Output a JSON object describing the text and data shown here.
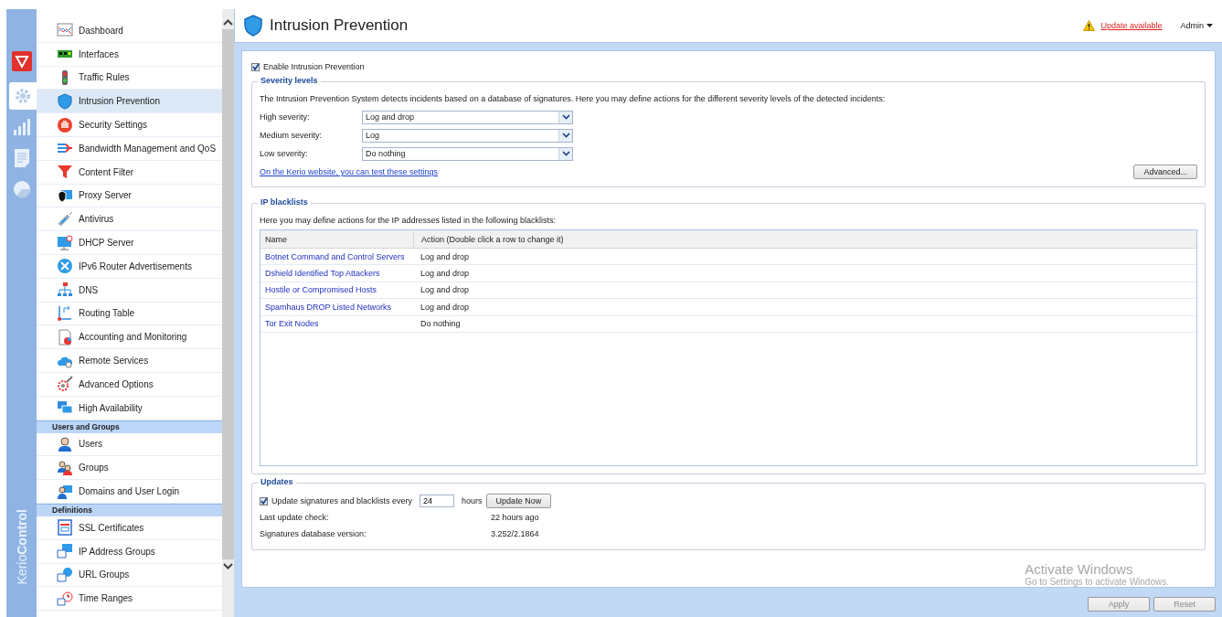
{
  "sidebar": {
    "rail": [
      {
        "selected": true
      },
      {
        "selected": false
      },
      {
        "selected": false
      },
      {
        "selected": false
      }
    ],
    "brand": "Kerio**Control**",
    "sections": [
      {
        "items": [
          {
            "label": "Dashboard",
            "selected": false
          },
          {
            "label": "Interfaces",
            "selected": false
          },
          {
            "label": "Traffic Rules",
            "selected": false
          },
          {
            "label": "Intrusion Prevention",
            "selected": true
          },
          {
            "label": "Security Settings",
            "selected": false
          },
          {
            "label": "Bandwidth Management and QoS",
            "selected": false
          },
          {
            "label": "Content Filter",
            "selected": false
          },
          {
            "label": "Proxy Server",
            "selected": false
          },
          {
            "label": "Antivirus",
            "selected": false
          },
          {
            "label": "DHCP Server",
            "selected": false
          },
          {
            "label": "IPv6 Router Advertisements",
            "selected": false
          },
          {
            "label": "DNS",
            "selected": false
          },
          {
            "label": "Routing Table",
            "selected": false
          },
          {
            "label": "Accounting and Monitoring",
            "selected": false
          },
          {
            "label": "Remote Services",
            "selected": false
          },
          {
            "label": "Advanced Options",
            "selected": false
          },
          {
            "label": "High Availability",
            "selected": false
          }
        ]
      },
      {
        "heading": "Users and Groups",
        "items": [
          {
            "label": "Users",
            "selected": false
          },
          {
            "label": "Groups",
            "selected": false
          },
          {
            "label": "Domains and User Login",
            "selected": false
          }
        ]
      },
      {
        "heading": "Definitions",
        "items": [
          {
            "label": "SSL Certificates",
            "selected": false
          },
          {
            "label": "IP Address Groups",
            "selected": false
          },
          {
            "label": "URL Groups",
            "selected": false
          },
          {
            "label": "Time Ranges",
            "selected": false
          }
        ]
      }
    ]
  },
  "header": {
    "title": "Intrusion Prevention",
    "update_link": "Update available",
    "user": "Admin"
  },
  "enable": {
    "label": "Enable Intrusion Prevention",
    "checked": true
  },
  "severity": {
    "legend": "Severity levels",
    "description": "The Intrusion Prevention System detects incidents based on a database of signatures. Here you may define actions for the different severity levels of the detected incidents:",
    "rows": [
      {
        "label": "High severity:",
        "value": "Log and drop"
      },
      {
        "label": "Medium severity:",
        "value": "Log"
      },
      {
        "label": "Low severity:",
        "value": "Do nothing"
      }
    ],
    "link": "On the Kerio website, you can test these settings",
    "button": "Advanced..."
  },
  "blacklists": {
    "legend": "IP blacklists",
    "description": "Here you may define actions for the IP addresses listed in the following blacklists:",
    "columns": [
      "Name",
      "Action (Double click a row to change it)"
    ],
    "rows": [
      {
        "name": "Botnet Command and Control Servers",
        "action": "Log and drop"
      },
      {
        "name": "Dshield Identified Top Attackers",
        "action": "Log and drop"
      },
      {
        "name": "Hostile or Compromised Hosts",
        "action": "Log and drop"
      },
      {
        "name": "Spamhaus DROP Listed Networks",
        "action": "Log and drop"
      },
      {
        "name": "Tor Exit Nodes",
        "action": "Do nothing"
      }
    ]
  },
  "updates": {
    "legend": "Updates",
    "auto": {
      "checked": true,
      "label": "Update signatures and blacklists every",
      "value": "24",
      "unit": "hours"
    },
    "button": "Update Now",
    "rows": [
      {
        "label": "Last update check:",
        "value": "22 hours ago"
      },
      {
        "label": "Signatures database version:",
        "value": "3.252/2.1864"
      }
    ]
  },
  "os_notice": {
    "title": "Activate Windows",
    "subtitle": "Go to Settings to activate Windows."
  },
  "footer_buttons": [
    {
      "label": "Apply",
      "disabled": true
    },
    {
      "label": "Reset",
      "disabled": true
    }
  ]
}
